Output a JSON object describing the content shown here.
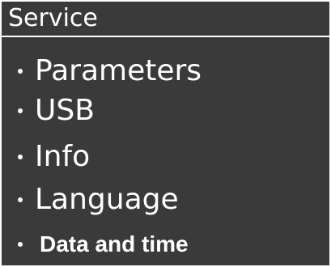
{
  "header": {
    "title": "Service"
  },
  "menu": {
    "items": [
      {
        "label": "Parameters",
        "selected": false
      },
      {
        "label": "USB",
        "selected": false
      },
      {
        "label": "Info",
        "selected": false
      },
      {
        "label": "Language",
        "selected": false
      },
      {
        "label": "Data and time",
        "selected": true
      }
    ]
  },
  "colors": {
    "background": "#3a3a3a",
    "text": "#ffffff",
    "border": "#ffffff"
  }
}
